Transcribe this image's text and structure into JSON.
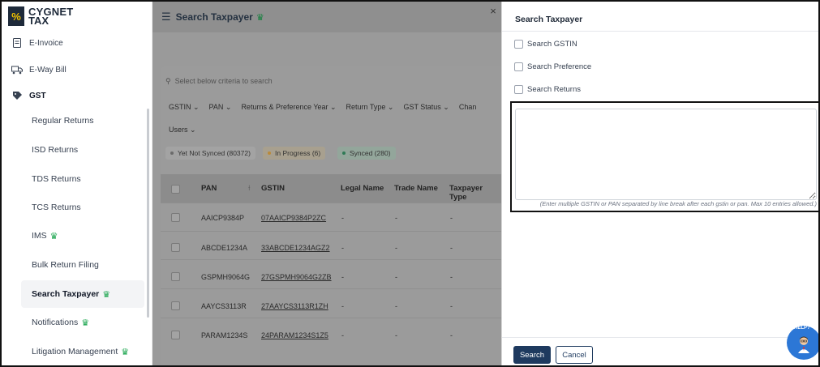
{
  "brand": {
    "line1": "CYGNET",
    "line2": "TAX"
  },
  "sidebar": {
    "top_items": [
      {
        "label": "E-Invoice",
        "icon": "invoice-icon"
      },
      {
        "label": "E-Way Bill",
        "icon": "truck-icon"
      },
      {
        "label": "GST",
        "icon": "gst-icon"
      }
    ],
    "sub_items": [
      {
        "label": "Regular Returns",
        "crown": false
      },
      {
        "label": "ISD Returns",
        "crown": false
      },
      {
        "label": "TDS Returns",
        "crown": false
      },
      {
        "label": "TCS Returns",
        "crown": false
      },
      {
        "label": "IMS",
        "crown": true
      },
      {
        "label": "Bulk Return Filing",
        "crown": false
      },
      {
        "label": "Search Taxpayer",
        "crown": true,
        "active": true
      },
      {
        "label": "Notifications",
        "crown": true
      },
      {
        "label": "Litigation Management",
        "crown": true
      }
    ]
  },
  "main": {
    "title": "Search Taxpayer",
    "search_placeholder": "Select below criteria to search",
    "filters": [
      "GSTIN ⌄",
      "PAN ⌄",
      "Returns & Preference Year ⌄",
      "Return Type ⌄",
      "GST Status ⌄",
      "Chan"
    ],
    "users_filter": "Users ⌄",
    "chips": [
      {
        "label": "Yet Not Synced (80372)",
        "color": "#8a8a8a"
      },
      {
        "label": "In Progress (6)",
        "color": "#e8a33c"
      },
      {
        "label": "Synced (280)",
        "color": "#22a06b"
      }
    ],
    "columns": [
      "PAN",
      "GSTIN",
      "Legal Name",
      "Trade Name",
      "Taxpayer Type"
    ],
    "rows": [
      {
        "pan": "AAICP9384P",
        "gstin": "07AAICP9384P2ZC",
        "legal": "-",
        "trade": "-",
        "type": "-"
      },
      {
        "pan": "ABCDE1234A",
        "gstin": "33ABCDE1234AGZ2",
        "legal": "-",
        "trade": "-",
        "type": "-"
      },
      {
        "pan": "GSPMH9064G",
        "gstin": "27GSPMH9064G2ZB",
        "legal": "-",
        "trade": "-",
        "type": "-"
      },
      {
        "pan": "AAYCS3113R",
        "gstin": "27AAYCS3113R1ZH",
        "legal": "-",
        "trade": "-",
        "type": "-"
      },
      {
        "pan": "PARAM1234S",
        "gstin": "24PARAM1234S1Z5",
        "legal": "-",
        "trade": "-",
        "type": "-"
      }
    ]
  },
  "panel": {
    "close": "×",
    "title": "Search Taxpayer",
    "options": [
      "Search GSTIN",
      "Search Preference",
      "Search Returns"
    ],
    "textarea_value": "",
    "hint": "(Enter multiple GSTIN or PAN separated by line break after each gstin or pan. Max 10 entries allowed.)",
    "search_label": "Search",
    "cancel_label": "Cancel",
    "help_label": "HELP?"
  },
  "colors": {
    "accent": "#1e3a5f",
    "crown": "#16a34a",
    "help": "#2c77d6"
  }
}
